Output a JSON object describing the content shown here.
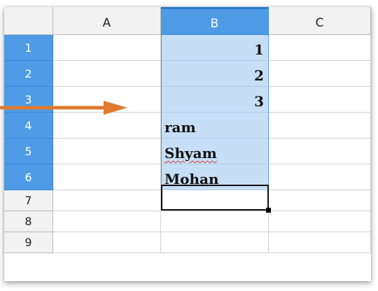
{
  "columns": [
    {
      "label": "A",
      "selected": false
    },
    {
      "label": "B",
      "selected": true
    },
    {
      "label": "C",
      "selected": false
    }
  ],
  "rows": [
    {
      "label": "1",
      "selected": true,
      "b": "1",
      "kind": "num"
    },
    {
      "label": "2",
      "selected": true,
      "b": "2",
      "kind": "num"
    },
    {
      "label": "3",
      "selected": true,
      "b": "3",
      "kind": "num"
    },
    {
      "label": "4",
      "selected": true,
      "b": "ram",
      "kind": "txt"
    },
    {
      "label": "5",
      "selected": true,
      "b": "Shyam",
      "kind": "txt",
      "misspelled": true
    },
    {
      "label": "6",
      "selected": true,
      "b": "Mohan",
      "kind": "txt"
    },
    {
      "label": "7",
      "selected": false,
      "b": ""
    },
    {
      "label": "8",
      "selected": false,
      "b": ""
    },
    {
      "label": "9",
      "selected": false,
      "b": ""
    }
  ],
  "active_cell": "B6",
  "colors": {
    "header_selected": "#4f9be6",
    "selection_fill": "#c6dff7",
    "arrow": "#e07a2c",
    "spellcheck": "#e0302a"
  },
  "icons": [
    "right-arrow-icon"
  ]
}
